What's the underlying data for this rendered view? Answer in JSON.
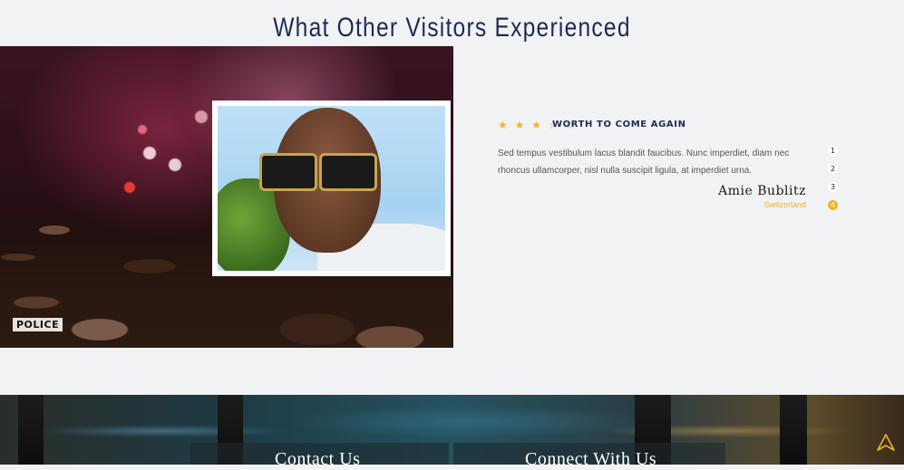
{
  "section": {
    "title": "What Other Visitors Experienced"
  },
  "testimonial": {
    "rating": 3,
    "rating_max": 5,
    "stars_text": "★ ★ ★ ☆ ☆",
    "title": "WORTH TO COME AGAIN",
    "body": "Sed tempus vestibulum lacus blandit faucibus. Nunc imperdiet, diam nec rhoncus ullamcorper, nisl nulla suscipit ligula, at imperdiet urna.",
    "name": "Amie Bublitz",
    "location": "Switzerland"
  },
  "pager": {
    "items": [
      "1",
      "2",
      "3",
      "4"
    ],
    "active": "4"
  },
  "hero_image": {
    "sign_text": "POLICE"
  },
  "footer": {
    "contact_heading": "Contact Us",
    "connect_heading": "Connect With Us"
  },
  "colors": {
    "accent": "#f0b429",
    "heading": "#1d2a57",
    "background": "#f1f2f4"
  },
  "icons": {
    "scroll_top": "up-arrow-icon",
    "star": "star-icon"
  }
}
